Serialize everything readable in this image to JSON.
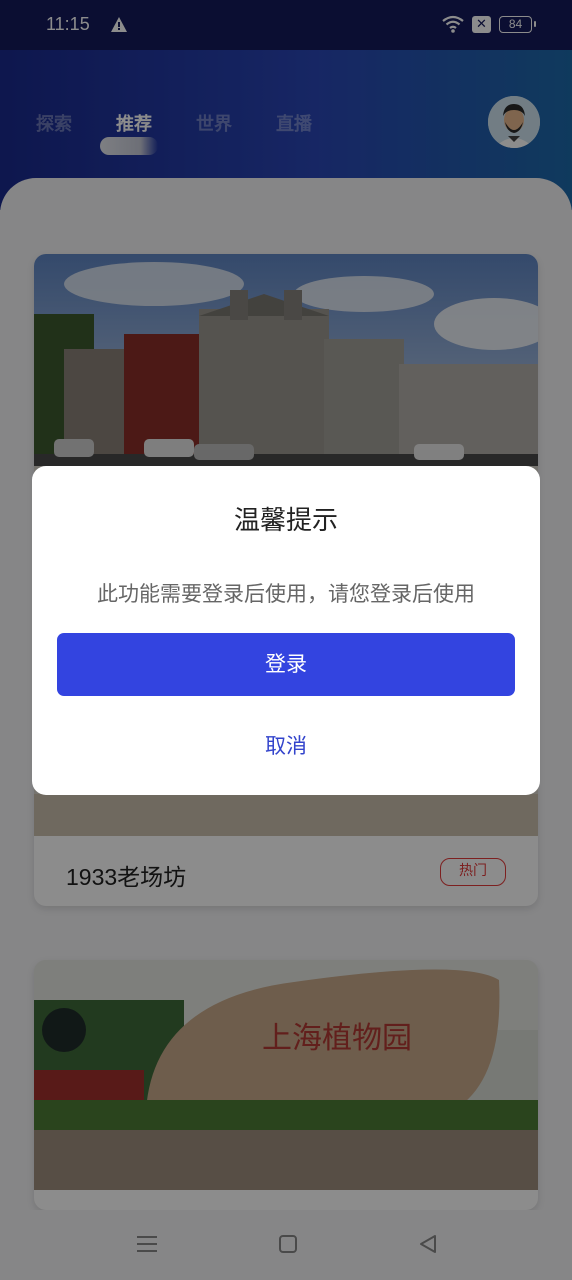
{
  "status_bar": {
    "time": "11:15",
    "battery": "84"
  },
  "header": {
    "tabs": [
      {
        "label": "探索"
      },
      {
        "label": "推荐"
      },
      {
        "label": "世界"
      },
      {
        "label": "直播"
      }
    ],
    "active_tab": "推荐"
  },
  "cards": [
    {
      "title": "1933老场坊",
      "badge": "热门",
      "image": "street-building-photo"
    },
    {
      "title": "",
      "image": "shanghai-botanical-garden-stone-photo",
      "stone_text": "上海植物园"
    }
  ],
  "dialog": {
    "title": "温馨提示",
    "message": "此功能需要登录后使用，请您登录后使用",
    "login_label": "登录",
    "cancel_label": "取消"
  },
  "colors": {
    "header_start": "#1a2a8e",
    "header_end": "#1d6aaa",
    "primary_button": "#3344e0",
    "badge_red": "#e33b3b"
  }
}
